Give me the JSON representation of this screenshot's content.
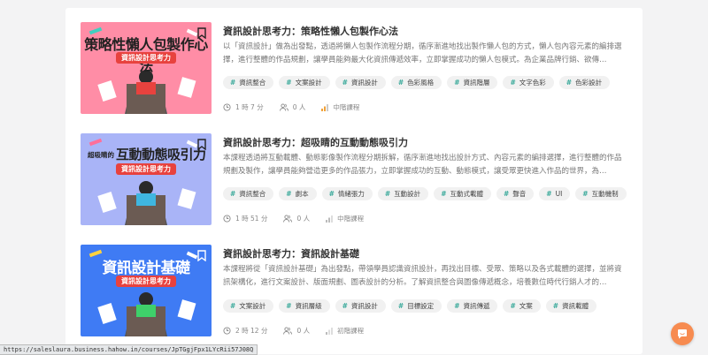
{
  "courses": [
    {
      "title": "資訊設計思考力：策略性懶人包製作心法",
      "thumb_line1": "策略性懶人包製作心法",
      "thumb_line2": "資訊設計思考力",
      "thumb_bg": "#ff8da6",
      "description": "以「資訊設計」做為出發點，透過將懶人包製作流程分期，循序漸進地找出製作懶人包的方式，懶人包內容元素的編排選擇，進行整體的作品規劃，讓學員能夠最大化資訊傳遞效率，立即掌握成功的懶人包模式。為企業品牌行銷、欲傳…",
      "tags": [
        "資訊整合",
        "文案設計",
        "資訊設計",
        "色彩風格",
        "資訊階層",
        "文字色彩",
        "色彩設計"
      ],
      "duration": "1 時 7 分",
      "students": "0 人",
      "level": "中階課程"
    },
    {
      "title": "資訊設計思考力：超吸睛的互動動態吸引力",
      "thumb_line1": "互動動態吸引力",
      "thumb_prefix": "超吸睛的",
      "thumb_line2": "資訊設計思考力",
      "thumb_bg": "#a9b4f7",
      "description": "本課程透過將互動載體、動態影像製作流程分期拆解，循序漸進地找出設計方式、內容元素的編排選擇，進行整體的作品規劃及製作，讓學員能夠營造更多的作品張力，立即掌握成功的互動、動態模式，讓受眾更快進入作品的世界，為…",
      "tags": [
        "資訊整合",
        "劇本",
        "情緒張力",
        "互動設計",
        "互動式載體",
        "聲音",
        "UI",
        "互動機制"
      ],
      "duration": "1 時 51 分",
      "students": "0 人",
      "level": "中階課程"
    },
    {
      "title": "資訊設計思考力：資訊設計基礎",
      "thumb_line1": "資訊設計基礎",
      "thumb_line2": "資訊設計思考力",
      "thumb_bg": "#3f7bf4",
      "description": "本課程將從「資訊設計基礎」為出發點，帶領學員認識資訊設計，再找出目標、受眾、策略以及各式載體的選擇，並將資訊架構化，進行文案設計、版面規劃、圖表設計的分析。了解資訊整合與圖像傳遞概念，培養數位時代行銷人才的…",
      "tags": [
        "文案設計",
        "資訊層級",
        "資訊設計",
        "目標設定",
        "資訊傳遞",
        "文案",
        "資訊載體"
      ],
      "duration": "2 時 12 分",
      "students": "0 人",
      "level": "初階課程"
    }
  ],
  "status_url": "https://saleslaura.business.hahow.in/courses/JpTGgjFpx1LYcRii57J08Q",
  "colors": {
    "tag_hash": "#39a99a",
    "chat_button": "#f78b50"
  },
  "icons": {
    "duration": "clock-icon",
    "students": "users-icon",
    "level": "level-bars-icon",
    "chat": "chat-icon",
    "bookmark": "bookmark-icon"
  }
}
